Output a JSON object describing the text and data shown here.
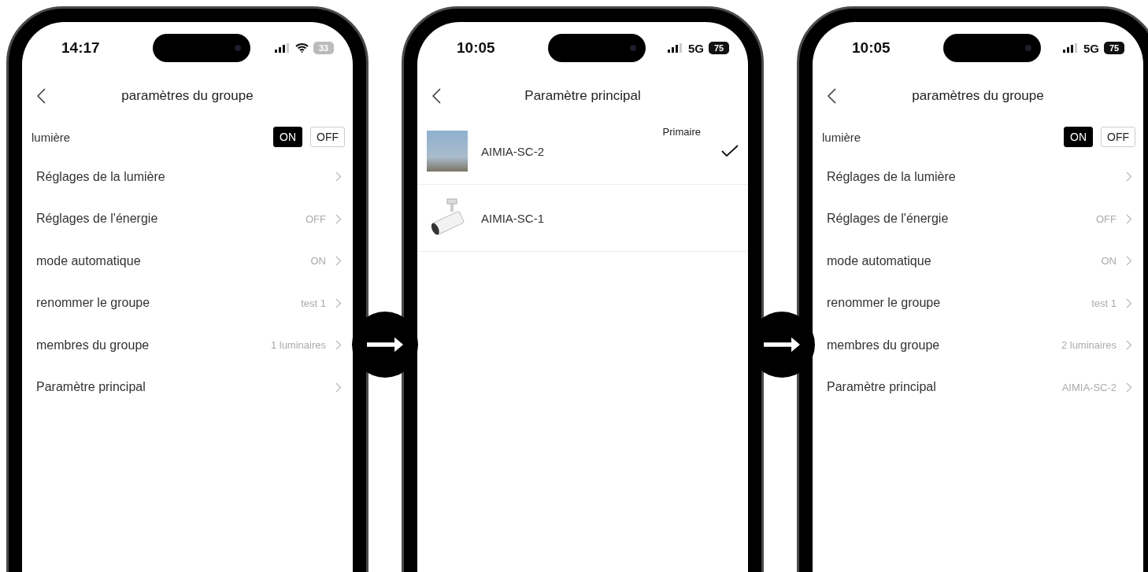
{
  "phones": [
    {
      "kind": "settings",
      "status": {
        "time": "14:17",
        "wifi": true,
        "battery": "33"
      },
      "title": "paramètres du groupe",
      "toggle": {
        "label": "lumière",
        "options": [
          {
            "label": "ON",
            "selected": true
          },
          {
            "label": "OFF",
            "selected": false
          }
        ]
      },
      "rows": [
        {
          "label": "Réglages de la lumière"
        },
        {
          "label": "Réglages de l'énergie",
          "value": "OFF"
        },
        {
          "label": "mode automatique",
          "value": "ON"
        },
        {
          "label": "renommer le groupe",
          "value": "test 1"
        },
        {
          "label": "membres du groupe",
          "value": "1 luminaires"
        },
        {
          "label": "Paramètre principal"
        }
      ]
    },
    {
      "kind": "devices",
      "status": {
        "time": "10:05",
        "network": "5G",
        "battery": "75"
      },
      "title": "Paramètre principal",
      "devices": [
        {
          "name": "AIMIA-SC-2",
          "tag": "Primaire",
          "checked": true,
          "kind": "photo"
        },
        {
          "name": "AIMIA-SC-1",
          "checked": false,
          "kind": "spotlight"
        }
      ]
    },
    {
      "kind": "settings",
      "status": {
        "time": "10:05",
        "network": "5G",
        "battery": "75"
      },
      "title": "paramètres du groupe",
      "toggle": {
        "label": "lumière",
        "options": [
          {
            "label": "ON",
            "selected": true
          },
          {
            "label": "OFF",
            "selected": false
          }
        ]
      },
      "rows": [
        {
          "label": "Réglages de la lumière"
        },
        {
          "label": "Réglages de l'énergie",
          "value": "OFF"
        },
        {
          "label": "mode automatique",
          "value": "ON"
        },
        {
          "label": "renommer le groupe",
          "value": "test 1"
        },
        {
          "label": "membres du groupe",
          "value": "2 luminaires"
        },
        {
          "label": "Paramètre principal",
          "value": "AIMIA-SC-2"
        }
      ]
    }
  ]
}
